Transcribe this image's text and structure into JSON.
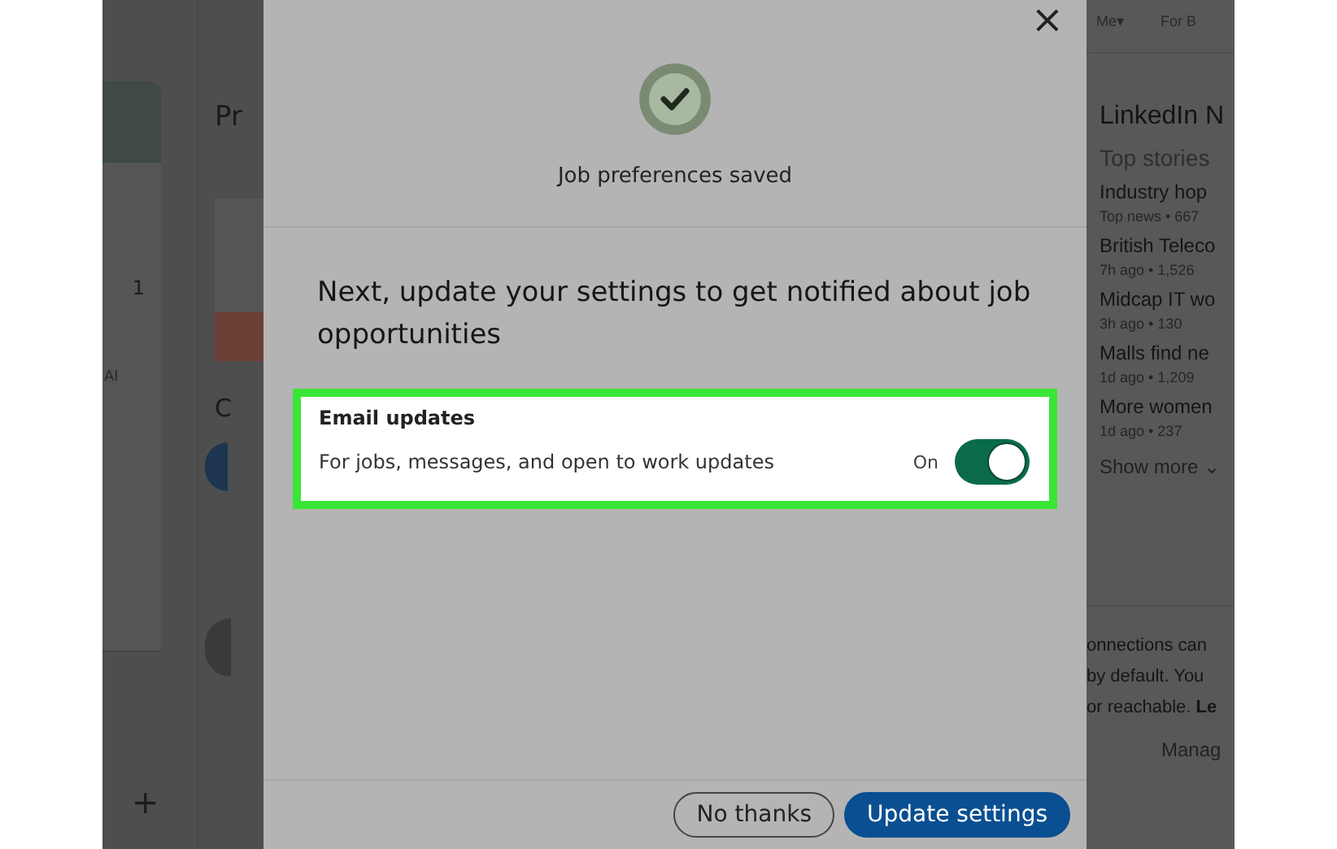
{
  "background_left": {
    "heading": "Pr",
    "count": "1",
    "label": "AI",
    "letter": "C",
    "add_symbol": "+"
  },
  "background_right": {
    "nav": [
      {
        "label": "Me",
        "caret": "▾"
      },
      {
        "label": "For B"
      }
    ],
    "title": "LinkedIn N",
    "subtitle": "Top stories",
    "stories": [
      {
        "headline": "Industry hop",
        "meta": "Top news • 667"
      },
      {
        "headline": "British Teleco",
        "meta": "7h ago • 1,526"
      },
      {
        "headline": "Midcap IT wo",
        "meta": "3h ago • 130"
      },
      {
        "headline": "Malls find ne",
        "meta": "1d ago • 1,209"
      },
      {
        "headline": "More women",
        "meta": "1d ago • 237"
      }
    ],
    "show_more": "Show more ⌄",
    "notice_lines": [
      "onnections can",
      "by default. You",
      "or reachable. "
    ],
    "notice_link": "Le",
    "manage": "Manag"
  },
  "modal": {
    "close": "×",
    "status": "Job preferences saved",
    "heading": "Next, update your settings to get notified about job opportunities",
    "setting": {
      "title": "Email updates",
      "description": "For jobs, messages, and open to work updates",
      "state_label": "On",
      "on": true,
      "highlighted": true
    },
    "buttons": [
      {
        "label": "No thanks",
        "kind": "secondary"
      },
      {
        "label": "Update settings",
        "kind": "primary"
      }
    ]
  }
}
